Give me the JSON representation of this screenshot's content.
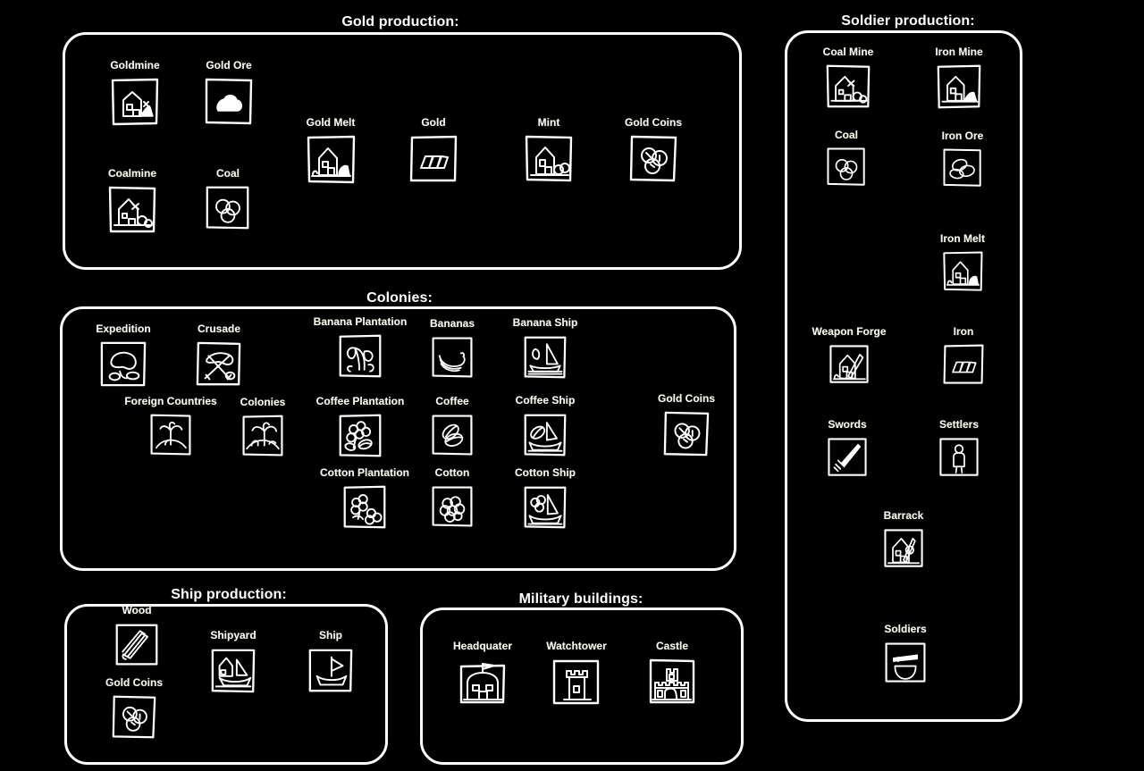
{
  "page": {
    "background": "#000000",
    "ink": "#ffffff",
    "label_color": "#fbfbf4",
    "title": "Anno style production chains overview"
  },
  "panels": [
    {
      "id": "gold",
      "title": "Gold production:",
      "nodes": [
        {
          "name": "goldmine",
          "label": "Goldmine",
          "icon": "mine-house-icon"
        },
        {
          "name": "gold-ore",
          "label": "Gold Ore",
          "icon": "ore-nugget-icon"
        },
        {
          "name": "coalmine",
          "label": "Coalmine",
          "icon": "coal-mine-house-icon"
        },
        {
          "name": "coal",
          "label": "Coal",
          "icon": "coal-lumps-icon"
        },
        {
          "name": "gold-melt",
          "label": "Gold Melt",
          "icon": "smelter-house-icon"
        },
        {
          "name": "gold",
          "label": "Gold",
          "icon": "gold-bars-icon"
        },
        {
          "name": "mint",
          "label": "Mint",
          "icon": "mint-house-icon"
        },
        {
          "name": "gold-coins",
          "label": "Gold Coins",
          "icon": "coins-icon"
        }
      ]
    },
    {
      "id": "colonies",
      "title": "Colonies:",
      "nodes": [
        {
          "name": "expedition",
          "label": "Expedition",
          "icon": "map-icon"
        },
        {
          "name": "foreign-countries",
          "label": "Foreign Countries",
          "icon": "island-palm-icon"
        },
        {
          "name": "crusade",
          "label": "Crusade",
          "icon": "crossed-swords-icon"
        },
        {
          "name": "colonies",
          "label": "Colonies",
          "icon": "colony-island-icon"
        },
        {
          "name": "banana-plantation",
          "label": "Banana Plantation",
          "icon": "banana-plant-icon"
        },
        {
          "name": "bananas",
          "label": "Bananas",
          "icon": "bananas-icon"
        },
        {
          "name": "banana-ship",
          "label": "Banana Ship",
          "icon": "ship-banana-icon"
        },
        {
          "name": "coffee-plantation",
          "label": "Coffee Plantation",
          "icon": "coffee-plant-icon"
        },
        {
          "name": "coffee",
          "label": "Coffee",
          "icon": "coffee-beans-icon"
        },
        {
          "name": "coffee-ship",
          "label": "Coffee Ship",
          "icon": "ship-coffee-icon"
        },
        {
          "name": "cotton-plantation",
          "label": "Cotton Plantation",
          "icon": "cotton-plant-icon"
        },
        {
          "name": "cotton",
          "label": "Cotton",
          "icon": "cotton-bolls-icon"
        },
        {
          "name": "cotton-ship",
          "label": "Cotton Ship",
          "icon": "ship-cotton-icon"
        },
        {
          "name": "gold-coins",
          "label": "Gold Coins",
          "icon": "coins-icon"
        }
      ]
    },
    {
      "id": "ship",
      "title": "Ship production:",
      "nodes": [
        {
          "name": "wood",
          "label": "Wood",
          "icon": "logs-icon"
        },
        {
          "name": "gold-coins",
          "label": "Gold Coins",
          "icon": "coins-icon"
        },
        {
          "name": "shipyard",
          "label": "Shipyard",
          "icon": "shipyard-icon"
        },
        {
          "name": "ship",
          "label": "Ship",
          "icon": "sailboat-icon"
        }
      ]
    },
    {
      "id": "military",
      "title": "Military buildings:",
      "nodes": [
        {
          "name": "headquater",
          "label": "Headquater",
          "icon": "headquarter-icon"
        },
        {
          "name": "watchtower",
          "label": "Watchtower",
          "icon": "tower-icon"
        },
        {
          "name": "castle",
          "label": "Castle",
          "icon": "castle-icon"
        }
      ]
    },
    {
      "id": "soldier",
      "title": "Soldier production:",
      "nodes": [
        {
          "name": "coal-mine",
          "label": "Coal Mine",
          "icon": "coal-mine-house-icon"
        },
        {
          "name": "iron-mine",
          "label": "Iron Mine",
          "icon": "mine-house-icon"
        },
        {
          "name": "coal",
          "label": "Coal",
          "icon": "coal-lumps-icon"
        },
        {
          "name": "iron-ore",
          "label": "Iron Ore",
          "icon": "ore-rocks-icon"
        },
        {
          "name": "iron-melt",
          "label": "Iron Melt",
          "icon": "smelter-house-icon"
        },
        {
          "name": "iron",
          "label": "Iron",
          "icon": "iron-bars-icon"
        },
        {
          "name": "weapon-forge",
          "label": "Weapon Forge",
          "icon": "forge-house-icon"
        },
        {
          "name": "swords",
          "label": "Swords",
          "icon": "sword-icon"
        },
        {
          "name": "settlers",
          "label": "Settlers",
          "icon": "settler-icon"
        },
        {
          "name": "barrack",
          "label": "Barrack",
          "icon": "barrack-house-icon"
        },
        {
          "name": "soldiers",
          "label": "Soldiers",
          "icon": "soldier-shield-icon"
        }
      ]
    }
  ]
}
